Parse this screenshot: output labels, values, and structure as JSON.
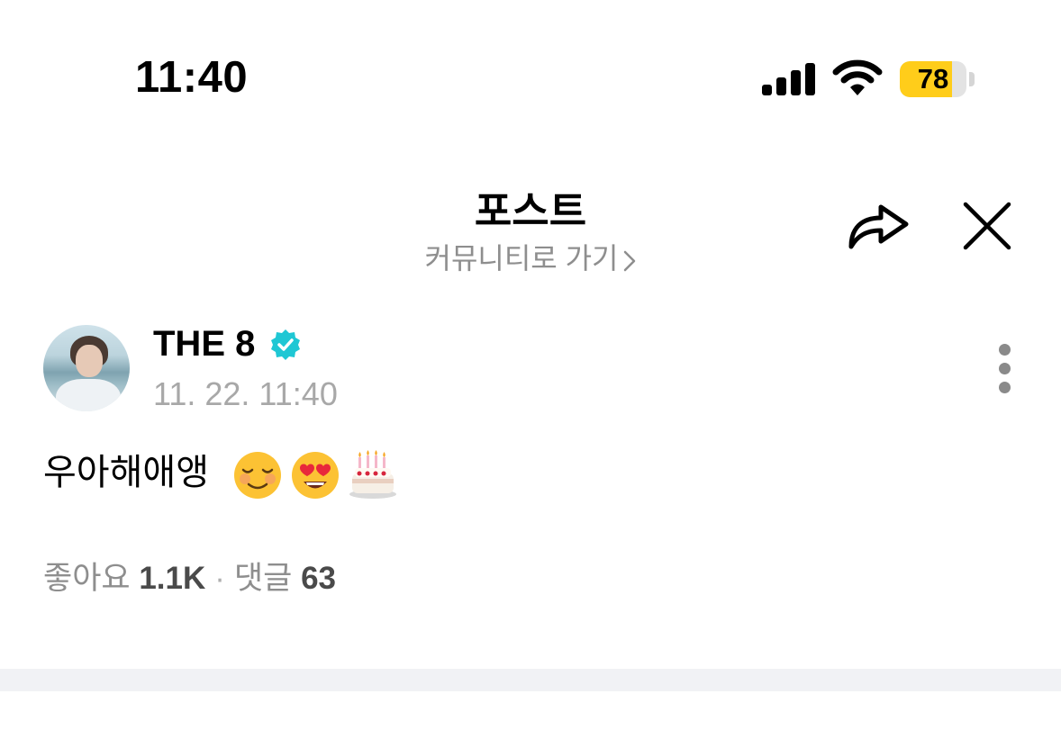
{
  "status_bar": {
    "time": "11:40",
    "battery_level": 78,
    "battery_text": "78",
    "battery_color": "#ffcd1a"
  },
  "header": {
    "title": "포스트",
    "community_link": "커뮤니티로 가기",
    "chevron_icon": "chevron-right-icon",
    "share_icon": "share-arrow-icon",
    "close_icon": "close-icon"
  },
  "post": {
    "author": "THE 8",
    "verified_icon": "verified-badge-icon",
    "verified_color": "#1fc7d4",
    "date": "11. 22. 11:40",
    "text": "우아해애앵",
    "emojis": [
      "smiling-face-icon",
      "heart-eyes-icon",
      "birthday-cake-icon"
    ],
    "more_icon": "more-vertical-icon"
  },
  "stats": {
    "likes_label": "좋아요",
    "likes_value": "1.1K",
    "separator": "·",
    "comments_label": "댓글",
    "comments_value": "63"
  }
}
